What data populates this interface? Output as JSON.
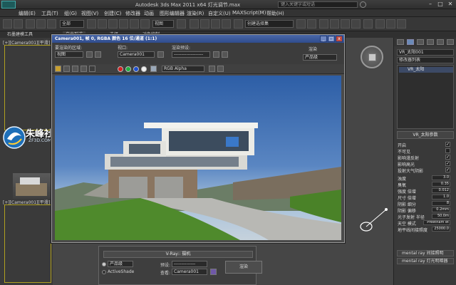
{
  "window": {
    "title": "Autodesk 3ds Max  2011 x64      灯光调节.max",
    "search_placeholder": "键入关键字或短语",
    "minimize": "–",
    "maximize": "□",
    "close": "✕"
  },
  "menubar": {
    "items": [
      "编辑(E)",
      "工具(T)",
      "组(G)",
      "视图(V)",
      "创建(C)",
      "修改器",
      "动画",
      "图形编辑器",
      "渲染(R)",
      "自定义(U)",
      "MAXScript(M)",
      "帮助(H)"
    ]
  },
  "toolbar": {
    "selection_filter": "全部",
    "view_select": "视图",
    "named_selection": "创建选择集"
  },
  "ribbon": {
    "tabs": [
      "石墨建模工具",
      "自由形式",
      "选择",
      "对象绘制"
    ]
  },
  "viewports": {
    "top_left_label": "[+][Camera001][平滑]",
    "bottom_left_label": "[+][Camera001][平滑]"
  },
  "watermark": {
    "brand": "朱峰社区",
    "url": "ZF3D.COM"
  },
  "render_window": {
    "title": "Camera001, 帧 0, RGBA 颜色 16 位/通道 (1:1)",
    "area_label": "要渲染的区域:",
    "area_value": "视图",
    "viewport_label": "视口:",
    "viewport_value": "Camera001",
    "preset_label": "渲染预设:",
    "preset_value": "-------------------",
    "render_button": "渲染",
    "product_value": "产品级",
    "channel_value": "RGB Alpha"
  },
  "right_panel": {
    "object_name": "VR_太阳001",
    "modifier_list": "修改器列表",
    "stack_item": "VR_太阳",
    "rollout_title": "VR_太阳参数",
    "params": [
      {
        "name": "开启",
        "type": "check",
        "value": "✓"
      },
      {
        "name": "不可见",
        "type": "check",
        "value": ""
      },
      {
        "name": "影响漫反射",
        "type": "check",
        "value": "✓"
      },
      {
        "name": "影响高光",
        "type": "check",
        "value": "✓"
      },
      {
        "name": "投射大气阴影",
        "type": "check",
        "value": "✓"
      },
      {
        "name": "浊度",
        "type": "value",
        "value": "3.0"
      },
      {
        "name": "臭氧",
        "type": "value",
        "value": "0.35"
      },
      {
        "name": "强度 倍增",
        "type": "value",
        "value": "0.012"
      },
      {
        "name": "尺寸 倍增",
        "type": "value",
        "value": "1.0"
      },
      {
        "name": "阴影 细分",
        "type": "value",
        "value": "8"
      },
      {
        "name": "阴影 偏移",
        "type": "value",
        "value": "0.2mm"
      },
      {
        "name": "光子发射 半径",
        "type": "value",
        "value": "50.0m"
      },
      {
        "name": "天空 模式",
        "type": "value",
        "value": "Preetham et"
      },
      {
        "name": "地平线间接照度",
        "type": "value",
        "value": "25000.0"
      }
    ],
    "bottom_rollouts": [
      "mental ray 间接照明",
      "mental ray 灯光明暗器"
    ]
  },
  "vray_panel": {
    "title": "V-Ray:: 摄机",
    "product": "产品级",
    "preset_label": "预设:",
    "preset_value": "--------------",
    "activeshade": "ActiveShade",
    "view_label": "查看:",
    "view_value": "Camera001",
    "render_button": "渲染"
  }
}
